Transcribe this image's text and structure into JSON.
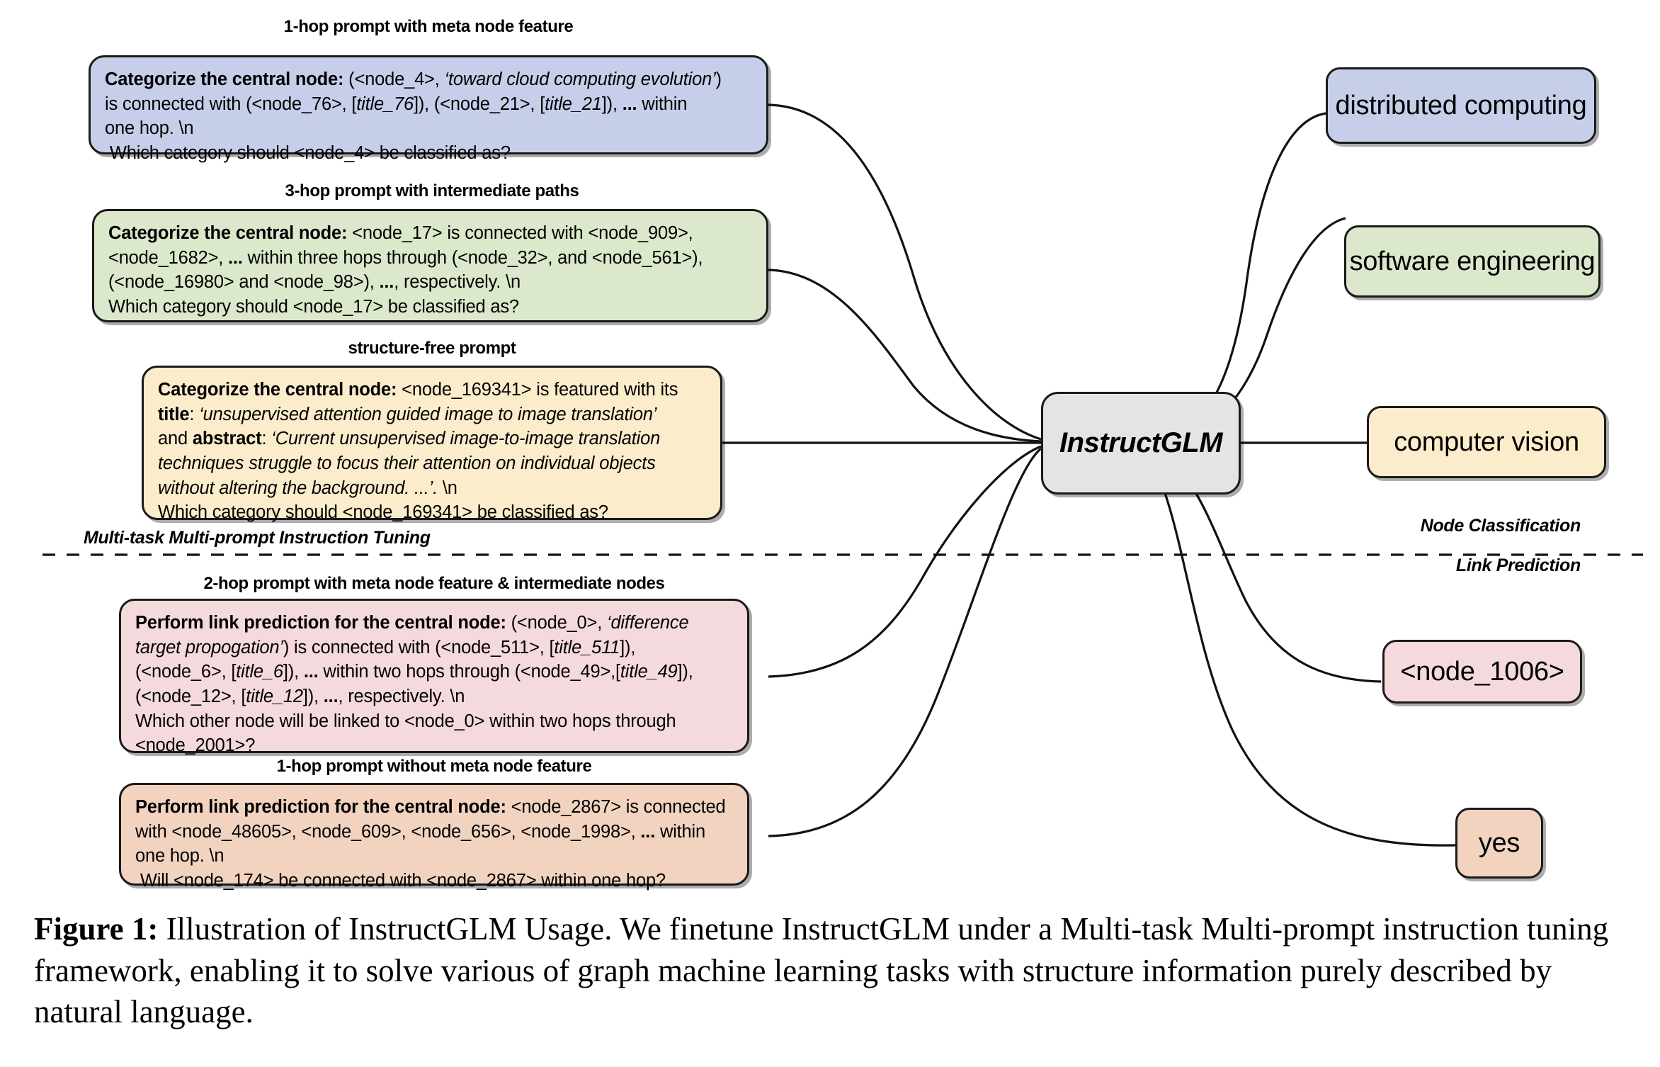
{
  "figure": {
    "model_node": {
      "label": "InstructGLM"
    },
    "divider_label": "Multi-task Multi-prompt Instruction Tuning",
    "task_labels": {
      "node_classification": "Node Classification",
      "link_prediction": "Link Prediction"
    },
    "prompts": [
      {
        "id": "one-hop-meta",
        "caption": "1-hop prompt with meta node feature",
        "color": "#c6cee9",
        "lines": [
          [
            {
              "t": "Categorize the central node:",
              "s": "bold"
            },
            {
              "t": " (<node_4>, ",
              "s": "normal"
            },
            {
              "t": "‘toward cloud computing evolution’",
              "s": "italic"
            },
            {
              "t": ")",
              "s": "normal"
            }
          ],
          [
            {
              "t": "is connected with (<node_76>, [",
              "s": "normal"
            },
            {
              "t": "title_76",
              "s": "italic"
            },
            {
              "t": "]), (<node_21>, [",
              "s": "normal"
            },
            {
              "t": "title_21",
              "s": "italic"
            },
            {
              "t": "]), ",
              "s": "normal"
            },
            {
              "t": "...",
              "s": "bold"
            },
            {
              "t": " within",
              "s": "normal"
            }
          ],
          [
            {
              "t": "one hop.  \\n",
              "s": "normal"
            }
          ],
          [
            {
              "t": " Which category should <node_4> be classified as?",
              "s": "normal"
            }
          ]
        ]
      },
      {
        "id": "three-hop-paths",
        "caption": "3-hop prompt with intermediate paths",
        "color": "#dbe8cb",
        "lines": [
          [
            {
              "t": "Categorize the central node:",
              "s": "bold"
            },
            {
              "t": " <node_17> is connected with <node_909>,",
              "s": "normal"
            }
          ],
          [
            {
              "t": "<node_1682>, ",
              "s": "normal"
            },
            {
              "t": "...",
              "s": "bold"
            },
            {
              "t": " within three hops through (<node_32>, and <node_561>),",
              "s": "normal"
            }
          ],
          [
            {
              "t": "(<node_16980> and <node_98>), ",
              "s": "normal"
            },
            {
              "t": "...",
              "s": "bold"
            },
            {
              "t": ", respectively.  \\n",
              "s": "normal"
            }
          ],
          [
            {
              "t": "Which category should <node_17> be classified as?",
              "s": "normal"
            }
          ]
        ]
      },
      {
        "id": "structure-free",
        "caption": "structure-free prompt",
        "color": "#fbeccb",
        "lines": [
          [
            {
              "t": "Categorize the central node:",
              "s": "bold"
            },
            {
              "t": " <node_169341> is featured with its",
              "s": "normal"
            }
          ],
          [
            {
              "t": "title",
              "s": "bold"
            },
            {
              "t": ": ",
              "s": "normal"
            },
            {
              "t": "‘unsupervised attention guided image to image translation’",
              "s": "italic"
            }
          ],
          [
            {
              "t": "and ",
              "s": "normal"
            },
            {
              "t": "abstract",
              "s": "bold"
            },
            {
              "t": ": ",
              "s": "normal"
            },
            {
              "t": "‘Current unsupervised image-to-image translation",
              "s": "italic"
            }
          ],
          [
            {
              "t": "techniques struggle to focus their attention on individual objects",
              "s": "italic"
            }
          ],
          [
            {
              "t": "without altering the background. ...’.",
              "s": "italic"
            },
            {
              "t": "  \\n",
              "s": "normal"
            }
          ],
          [
            {
              "t": "Which category should <node_169341> be classified as?",
              "s": "normal"
            }
          ]
        ]
      },
      {
        "id": "two-hop-meta-intermediate",
        "caption": "2-hop prompt with meta node feature & intermediate nodes",
        "color": "#f4d9dd",
        "lines": [
          [
            {
              "t": "Perform link prediction for the central node:",
              "s": "bold"
            },
            {
              "t": " (<node_0>, ",
              "s": "normal"
            },
            {
              "t": "‘difference",
              "s": "italic"
            }
          ],
          [
            {
              "t": "target propogation’",
              "s": "italic"
            },
            {
              "t": ") is connected with (<node_511>, [",
              "s": "normal"
            },
            {
              "t": "title_511",
              "s": "italic"
            },
            {
              "t": "]),",
              "s": "normal"
            }
          ],
          [
            {
              "t": "(<node_6>, [",
              "s": "normal"
            },
            {
              "t": "title_6",
              "s": "italic"
            },
            {
              "t": "]), ",
              "s": "normal"
            },
            {
              "t": "...",
              "s": "bold"
            },
            {
              "t": " within two hops through (<node_49>,[",
              "s": "normal"
            },
            {
              "t": "title_49",
              "s": "italic"
            },
            {
              "t": "]),",
              "s": "normal"
            }
          ],
          [
            {
              "t": "(<node_12>, [",
              "s": "normal"
            },
            {
              "t": "title_12",
              "s": "italic"
            },
            {
              "t": "]), ",
              "s": "normal"
            },
            {
              "t": "...",
              "s": "bold"
            },
            {
              "t": ", respectively.  \\n",
              "s": "normal"
            }
          ],
          [
            {
              "t": "Which other node will be linked to <node_0> within two hops through",
              "s": "normal"
            }
          ],
          [
            {
              "t": "<node_2001>?",
              "s": "normal"
            }
          ]
        ]
      },
      {
        "id": "one-hop-no-meta",
        "caption": "1-hop prompt without meta node feature",
        "color": "#f2d3c0",
        "lines": [
          [
            {
              "t": "Perform link prediction for the central node:",
              "s": "bold"
            },
            {
              "t": " <node_2867> is connected",
              "s": "normal"
            }
          ],
          [
            {
              "t": "with <node_48605>, <node_609>, <node_656>, <node_1998>, ",
              "s": "normal"
            },
            {
              "t": "...",
              "s": "bold"
            },
            {
              "t": " within",
              "s": "normal"
            }
          ],
          [
            {
              "t": "one hop.  \\n",
              "s": "normal"
            }
          ],
          [
            {
              "t": " Will <node_174> be connected with <node_2867> within one hop?",
              "s": "normal"
            }
          ]
        ]
      }
    ],
    "answers": [
      {
        "id": "distributed-computing",
        "label": "distributed computing",
        "color": "#c6cee9"
      },
      {
        "id": "software-engineering",
        "label": "software engineering",
        "color": "#dbe8cb"
      },
      {
        "id": "computer-vision",
        "label": "computer vision",
        "color": "#fbeccb"
      },
      {
        "id": "node-1006",
        "label": "<node_1006>",
        "color": "#f4d9dd"
      },
      {
        "id": "yes",
        "label": "yes",
        "color": "#f2d3c0"
      }
    ]
  },
  "caption": {
    "label": "Figure 1:",
    "text": " Illustration of InstructGLM Usage. We finetune InstructGLM under a Multi-task Multi-prompt instruction tuning framework, enabling it to solve various of graph machine learning tasks with structure information purely described by natural language."
  }
}
